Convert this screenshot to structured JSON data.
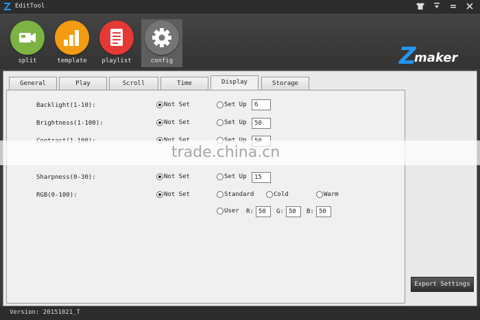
{
  "window": {
    "title": "EditTool",
    "controls": [
      "shirt-icon",
      "minimize",
      "maximize",
      "close"
    ]
  },
  "toolbar": {
    "items": [
      {
        "label": "split",
        "icon": "video-camera-icon",
        "color": "#7cb342"
      },
      {
        "label": "template",
        "icon": "bar-chart-icon",
        "color": "#f39c12"
      },
      {
        "label": "playlist",
        "icon": "document-list-icon",
        "color": "#e53935"
      },
      {
        "label": "config",
        "icon": "gear-icon",
        "color": "#757575",
        "active": true
      }
    ],
    "brand": {
      "z": "Z",
      "text": "maker",
      "color": "#2196f3"
    }
  },
  "tabs": [
    {
      "label": "General"
    },
    {
      "label": "Play"
    },
    {
      "label": "Scroll"
    },
    {
      "label": "Time"
    },
    {
      "label": "Display",
      "active": true
    },
    {
      "label": "Storage"
    }
  ],
  "display": {
    "not_set_label": "Not Set",
    "set_up_label": "Set Up",
    "backlight": {
      "label": "Backlight(1-10):",
      "value": "6"
    },
    "brightness": {
      "label": "Brightness(1-100):",
      "value": "50"
    },
    "contrast": {
      "label": "Contrast(1-100):",
      "value": "50"
    },
    "sharpness": {
      "label": "Sharpness(0-30):",
      "value": "15"
    },
    "rgb": {
      "label": "RGB(0-100):",
      "standard": "Standard",
      "cold": "Cold",
      "warm": "Warm",
      "user": "User",
      "r_label": "R:",
      "r_value": "50",
      "g_label": "G:",
      "g_value": "50",
      "b_label": "B:",
      "b_value": "50"
    }
  },
  "export_button": "Export Settings",
  "watermark": "trade.china.cn",
  "status": {
    "version": "Version: 20151021_T"
  }
}
